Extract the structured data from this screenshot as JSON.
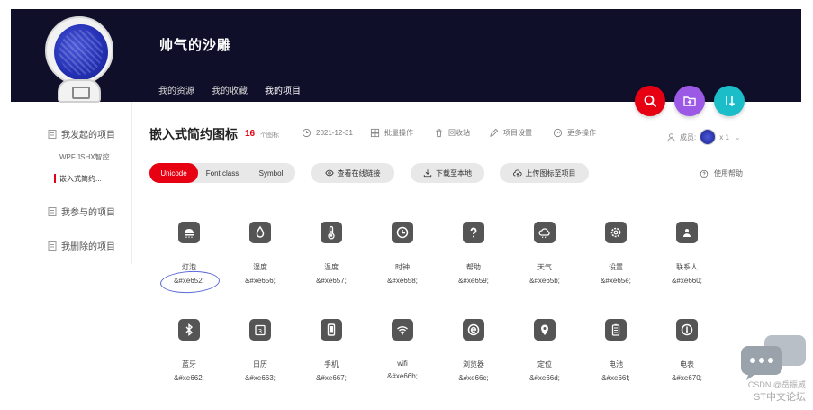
{
  "header": {
    "username": "帅气的沙雕",
    "tabs": [
      {
        "label": "我的资源"
      },
      {
        "label": "我的收藏"
      },
      {
        "label": "我的项目"
      }
    ]
  },
  "sidebar": {
    "started": "我发起的项目",
    "sub_items": [
      "WPF.JSHX智控",
      "嵌入式简约..."
    ],
    "joined": "我参与的项目",
    "archived": "我删除的项目"
  },
  "project": {
    "title": "嵌入式简约图标",
    "icon_count": "16",
    "icon_count_label": "个图标",
    "date": "2021-12-31",
    "batch": "批量操作",
    "trash": "回收站",
    "settings": "项目设置",
    "more": "更多操作",
    "members_label": "成员:",
    "members_count": "x 1"
  },
  "toolbar": {
    "toggle": [
      "Unicode",
      "Font class",
      "Symbol"
    ],
    "view_online": "查看在线链接",
    "download": "下载至本地",
    "upload": "上传图标至项目",
    "help": "使用帮助"
  },
  "icons": [
    {
      "name": "灯泡",
      "code": "&#xe652;",
      "icon": "lamp-icon"
    },
    {
      "name": "湿度",
      "code": "&#xe656;",
      "icon": "humidity-icon"
    },
    {
      "name": "温度",
      "code": "&#xe657;",
      "icon": "thermometer-icon"
    },
    {
      "name": "时钟",
      "code": "&#xe658;",
      "icon": "clock-icon"
    },
    {
      "name": "帮助",
      "code": "&#xe659;",
      "icon": "help-icon"
    },
    {
      "name": "天气",
      "code": "&#xe65b;",
      "icon": "weather-icon"
    },
    {
      "name": "设置",
      "code": "&#xe65e;",
      "icon": "settings-icon"
    },
    {
      "name": "联系人",
      "code": "&#xe660;",
      "icon": "contact-icon"
    },
    {
      "name": "蓝牙",
      "code": "&#xe662;",
      "icon": "bluetooth-icon"
    },
    {
      "name": "日历",
      "code": "&#xe663;",
      "icon": "calendar-icon"
    },
    {
      "name": "手机",
      "code": "&#xe667;",
      "icon": "phone-icon"
    },
    {
      "name": "wifi",
      "code": "&#xe66b;",
      "icon": "wifi-icon"
    },
    {
      "name": "浏览器",
      "code": "&#xe66c;",
      "icon": "browser-icon"
    },
    {
      "name": "定位",
      "code": "&#xe66d;",
      "icon": "location-icon"
    },
    {
      "name": "电池",
      "code": "&#xe66f;",
      "icon": "battery-icon"
    },
    {
      "name": "电表",
      "code": "&#xe670;",
      "icon": "meter-icon"
    }
  ],
  "watermark": {
    "line1": "CSDN @岳振威",
    "line2": "ST中文论坛"
  },
  "colors": {
    "accent": "#e60012",
    "header_bg": "#0f0f2a",
    "purple": "#9b59e6",
    "teal": "#1bbdc9"
  }
}
